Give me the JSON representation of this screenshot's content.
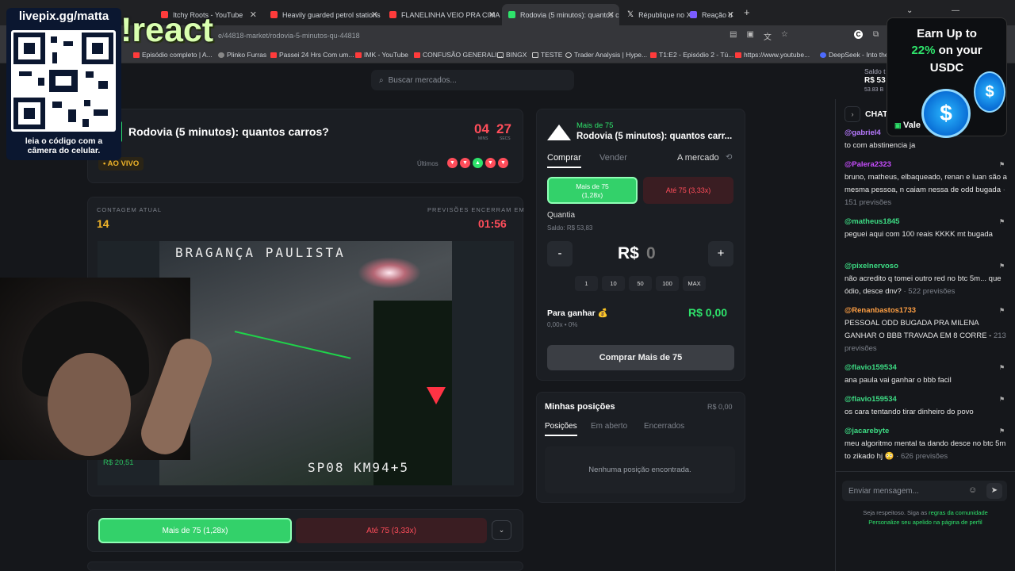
{
  "browser": {
    "tabs": [
      {
        "label": "Itchy Roots - YouTube",
        "color": "#ff3b3b"
      },
      {
        "label": "Heavily guarded petrol stations",
        "color": "#ff3b3b"
      },
      {
        "label": "FLANELINHA VEIO PRA CIMA, D",
        "color": "#ff3b3b"
      },
      {
        "label": "Rodovia (5 minutos): quantos c",
        "color": "#2ee36b"
      },
      {
        "label": "République no X: \"",
        "color": "#cccccc"
      },
      {
        "label": "Reação d",
        "color": "#7b5cff"
      }
    ],
    "url": "e/44818-market/rodovia-5-minutos-qu-44818",
    "bookmarks": [
      "Episódio completo | A...",
      "Plinko Furras",
      "Passei 24 Hrs Com um...",
      "IMK - YouTube",
      "CONFUSÃO GENERALI...",
      "BINGX",
      "TESTE",
      "Trader Analysis | Hype...",
      "T1:E2 - Episódio 2 - Tú...",
      "https://www.youtube...",
      "DeepSeek - Into the"
    ]
  },
  "overlays": {
    "qr_title": "livepix.gg/matta",
    "qr_caption_1": "leia o código com a",
    "qr_caption_2": "câmera do celular.",
    "react": "!react",
    "promo_line1": "Earn Up to",
    "promo_line2_a": "22%",
    "promo_line2_b": " on your",
    "promo_line3": "USDC",
    "promo_tag": "Vale"
  },
  "header": {
    "search_placeholder": "Buscar mercados...",
    "saldo_label": "Saldo t",
    "saldo_value": "R$ 53",
    "saldo_sub": "53.83 B"
  },
  "market": {
    "title": "Rodovia (5 minutos): quantos carros?",
    "live": "• AO VIVO",
    "timer_min": "04",
    "timer_sec": "27",
    "timer_min_label": "MINS",
    "timer_sec_label": "SECS",
    "ultimos": "Últimos",
    "count_label": "CONTAGEM ATUAL",
    "count_value": "14",
    "closes_label": "PREVISÕES ENCERRAM EM",
    "closes_value": "01:56",
    "cam_top_text": "BRAGANÇA PAULISTA",
    "cam_bottom_text": "SP08 KM94+5",
    "webcam_price": "R$ 20,51",
    "btn_over": "Mais de 75 (1,28x)",
    "btn_under": "Até 75 (3,33x)"
  },
  "trade": {
    "side_label": "Mais de 75",
    "title": "Rodovia (5 minutos): quantos carr...",
    "tab_buy": "Comprar",
    "tab_sell": "Vender",
    "order_type": "A mercado",
    "opt_over": "Mais de 75",
    "opt_over_odds": "(1,28x)",
    "opt_under": "Até 75 (3,33x)",
    "qty_label": "Quantia",
    "balance": "Saldo: R$ 53,83",
    "minus": "-",
    "plus": "+",
    "amount": "0",
    "currency": "R$",
    "presets": [
      "1",
      "10",
      "50",
      "100",
      "MAX"
    ],
    "to_win_label": "Para ganhar 💰",
    "to_win_value": "R$ 0,00",
    "to_win_sub": "0,00x • 0%",
    "buy_button": "Comprar Mais de 75"
  },
  "positions": {
    "title": "Minhas posições",
    "total": "R$ 0,00",
    "tabs": [
      "Posições",
      "Em aberto",
      "Encerrados"
    ],
    "empty": "Nenhuma posição encontrada."
  },
  "chat": {
    "title": "CHAT",
    "messages": [
      {
        "user": "@gabriel4",
        "text": "to com abstinencia ja",
        "color": "#b779ff"
      },
      {
        "user": "@Palera2323",
        "text": "bruno, matheus, elbaqueado, renan e luan são a mesma pessoa, n caiam nessa de odd bugada",
        "extra": " · 151 previsões",
        "color": "#c84dff"
      },
      {
        "user": "@matheus1845",
        "text": "peguei aqui com 100 reais KKKK mt bugada",
        "color": "#3ddc84"
      },
      {
        "user": "@pixelnervoso",
        "text": "não acredito q tomei outro red no btc 5m... que ódio, desce dnv?",
        "extra": " · 522 previsões",
        "color": "#3ddc84"
      },
      {
        "user": "@Renanbastos1733",
        "text": "PESSOAL ODD BUGADA PRA MILENA GANHAR O BBB TRAVADA EM 8 CORRE -",
        "extra": "213 previsões",
        "color": "#ff9f43"
      },
      {
        "user": "@flavio159534",
        "text": "ana paula vai ganhar o bbb facil",
        "color": "#3ddc84"
      },
      {
        "user": "@flavio159534",
        "text": "os cara tentando tirar dinheiro do povo",
        "color": "#3ddc84"
      },
      {
        "user": "@jacarebyte",
        "text": "meu algoritmo mental ta dando desce no btc 5m to zikado hj 😳",
        "extra": " · 626 previsões",
        "color": "#3ddc84"
      }
    ],
    "input_placeholder": "Enviar mensagem...",
    "rules_prefix": "Seja respeitoso. Siga as ",
    "rules_link": "regras da comunidade",
    "nick_text": "Personalize seu apelido na página de perfil"
  }
}
